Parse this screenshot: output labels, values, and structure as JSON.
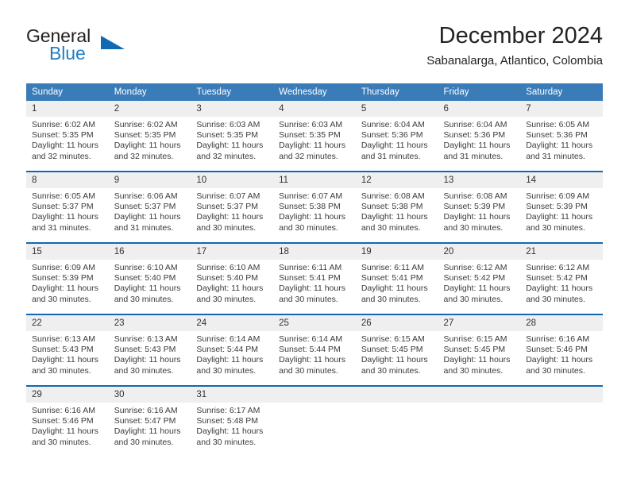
{
  "logo": {
    "word_one": "General",
    "word_two": "Blue",
    "icon": "triangle-icon",
    "accent_color": "#1268b3"
  },
  "header": {
    "title": "December 2024",
    "subtitle": "Sabanalarga, Atlantico, Colombia"
  },
  "theme": {
    "header_row_bg": "#3a7cb8",
    "divider_color": "#1268b3",
    "daynum_bg": "#efefef",
    "text_color": "#3b3b3b"
  },
  "calendar": {
    "weekday_headers": [
      "Sunday",
      "Monday",
      "Tuesday",
      "Wednesday",
      "Thursday",
      "Friday",
      "Saturday"
    ],
    "weeks": [
      [
        {
          "day": "1",
          "sunrise": "Sunrise: 6:02 AM",
          "sunset": "Sunset: 5:35 PM",
          "daylight": "Daylight: 11 hours and 32 minutes."
        },
        {
          "day": "2",
          "sunrise": "Sunrise: 6:02 AM",
          "sunset": "Sunset: 5:35 PM",
          "daylight": "Daylight: 11 hours and 32 minutes."
        },
        {
          "day": "3",
          "sunrise": "Sunrise: 6:03 AM",
          "sunset": "Sunset: 5:35 PM",
          "daylight": "Daylight: 11 hours and 32 minutes."
        },
        {
          "day": "4",
          "sunrise": "Sunrise: 6:03 AM",
          "sunset": "Sunset: 5:35 PM",
          "daylight": "Daylight: 11 hours and 32 minutes."
        },
        {
          "day": "5",
          "sunrise": "Sunrise: 6:04 AM",
          "sunset": "Sunset: 5:36 PM",
          "daylight": "Daylight: 11 hours and 31 minutes."
        },
        {
          "day": "6",
          "sunrise": "Sunrise: 6:04 AM",
          "sunset": "Sunset: 5:36 PM",
          "daylight": "Daylight: 11 hours and 31 minutes."
        },
        {
          "day": "7",
          "sunrise": "Sunrise: 6:05 AM",
          "sunset": "Sunset: 5:36 PM",
          "daylight": "Daylight: 11 hours and 31 minutes."
        }
      ],
      [
        {
          "day": "8",
          "sunrise": "Sunrise: 6:05 AM",
          "sunset": "Sunset: 5:37 PM",
          "daylight": "Daylight: 11 hours and 31 minutes."
        },
        {
          "day": "9",
          "sunrise": "Sunrise: 6:06 AM",
          "sunset": "Sunset: 5:37 PM",
          "daylight": "Daylight: 11 hours and 31 minutes."
        },
        {
          "day": "10",
          "sunrise": "Sunrise: 6:07 AM",
          "sunset": "Sunset: 5:37 PM",
          "daylight": "Daylight: 11 hours and 30 minutes."
        },
        {
          "day": "11",
          "sunrise": "Sunrise: 6:07 AM",
          "sunset": "Sunset: 5:38 PM",
          "daylight": "Daylight: 11 hours and 30 minutes."
        },
        {
          "day": "12",
          "sunrise": "Sunrise: 6:08 AM",
          "sunset": "Sunset: 5:38 PM",
          "daylight": "Daylight: 11 hours and 30 minutes."
        },
        {
          "day": "13",
          "sunrise": "Sunrise: 6:08 AM",
          "sunset": "Sunset: 5:39 PM",
          "daylight": "Daylight: 11 hours and 30 minutes."
        },
        {
          "day": "14",
          "sunrise": "Sunrise: 6:09 AM",
          "sunset": "Sunset: 5:39 PM",
          "daylight": "Daylight: 11 hours and 30 minutes."
        }
      ],
      [
        {
          "day": "15",
          "sunrise": "Sunrise: 6:09 AM",
          "sunset": "Sunset: 5:39 PM",
          "daylight": "Daylight: 11 hours and 30 minutes."
        },
        {
          "day": "16",
          "sunrise": "Sunrise: 6:10 AM",
          "sunset": "Sunset: 5:40 PM",
          "daylight": "Daylight: 11 hours and 30 minutes."
        },
        {
          "day": "17",
          "sunrise": "Sunrise: 6:10 AM",
          "sunset": "Sunset: 5:40 PM",
          "daylight": "Daylight: 11 hours and 30 minutes."
        },
        {
          "day": "18",
          "sunrise": "Sunrise: 6:11 AM",
          "sunset": "Sunset: 5:41 PM",
          "daylight": "Daylight: 11 hours and 30 minutes."
        },
        {
          "day": "19",
          "sunrise": "Sunrise: 6:11 AM",
          "sunset": "Sunset: 5:41 PM",
          "daylight": "Daylight: 11 hours and 30 minutes."
        },
        {
          "day": "20",
          "sunrise": "Sunrise: 6:12 AM",
          "sunset": "Sunset: 5:42 PM",
          "daylight": "Daylight: 11 hours and 30 minutes."
        },
        {
          "day": "21",
          "sunrise": "Sunrise: 6:12 AM",
          "sunset": "Sunset: 5:42 PM",
          "daylight": "Daylight: 11 hours and 30 minutes."
        }
      ],
      [
        {
          "day": "22",
          "sunrise": "Sunrise: 6:13 AM",
          "sunset": "Sunset: 5:43 PM",
          "daylight": "Daylight: 11 hours and 30 minutes."
        },
        {
          "day": "23",
          "sunrise": "Sunrise: 6:13 AM",
          "sunset": "Sunset: 5:43 PM",
          "daylight": "Daylight: 11 hours and 30 minutes."
        },
        {
          "day": "24",
          "sunrise": "Sunrise: 6:14 AM",
          "sunset": "Sunset: 5:44 PM",
          "daylight": "Daylight: 11 hours and 30 minutes."
        },
        {
          "day": "25",
          "sunrise": "Sunrise: 6:14 AM",
          "sunset": "Sunset: 5:44 PM",
          "daylight": "Daylight: 11 hours and 30 minutes."
        },
        {
          "day": "26",
          "sunrise": "Sunrise: 6:15 AM",
          "sunset": "Sunset: 5:45 PM",
          "daylight": "Daylight: 11 hours and 30 minutes."
        },
        {
          "day": "27",
          "sunrise": "Sunrise: 6:15 AM",
          "sunset": "Sunset: 5:45 PM",
          "daylight": "Daylight: 11 hours and 30 minutes."
        },
        {
          "day": "28",
          "sunrise": "Sunrise: 6:16 AM",
          "sunset": "Sunset: 5:46 PM",
          "daylight": "Daylight: 11 hours and 30 minutes."
        }
      ],
      [
        {
          "day": "29",
          "sunrise": "Sunrise: 6:16 AM",
          "sunset": "Sunset: 5:46 PM",
          "daylight": "Daylight: 11 hours and 30 minutes."
        },
        {
          "day": "30",
          "sunrise": "Sunrise: 6:16 AM",
          "sunset": "Sunset: 5:47 PM",
          "daylight": "Daylight: 11 hours and 30 minutes."
        },
        {
          "day": "31",
          "sunrise": "Sunrise: 6:17 AM",
          "sunset": "Sunset: 5:48 PM",
          "daylight": "Daylight: 11 hours and 30 minutes."
        },
        {
          "day": "",
          "sunrise": "",
          "sunset": "",
          "daylight": ""
        },
        {
          "day": "",
          "sunrise": "",
          "sunset": "",
          "daylight": ""
        },
        {
          "day": "",
          "sunrise": "",
          "sunset": "",
          "daylight": ""
        },
        {
          "day": "",
          "sunrise": "",
          "sunset": "",
          "daylight": ""
        }
      ]
    ]
  }
}
